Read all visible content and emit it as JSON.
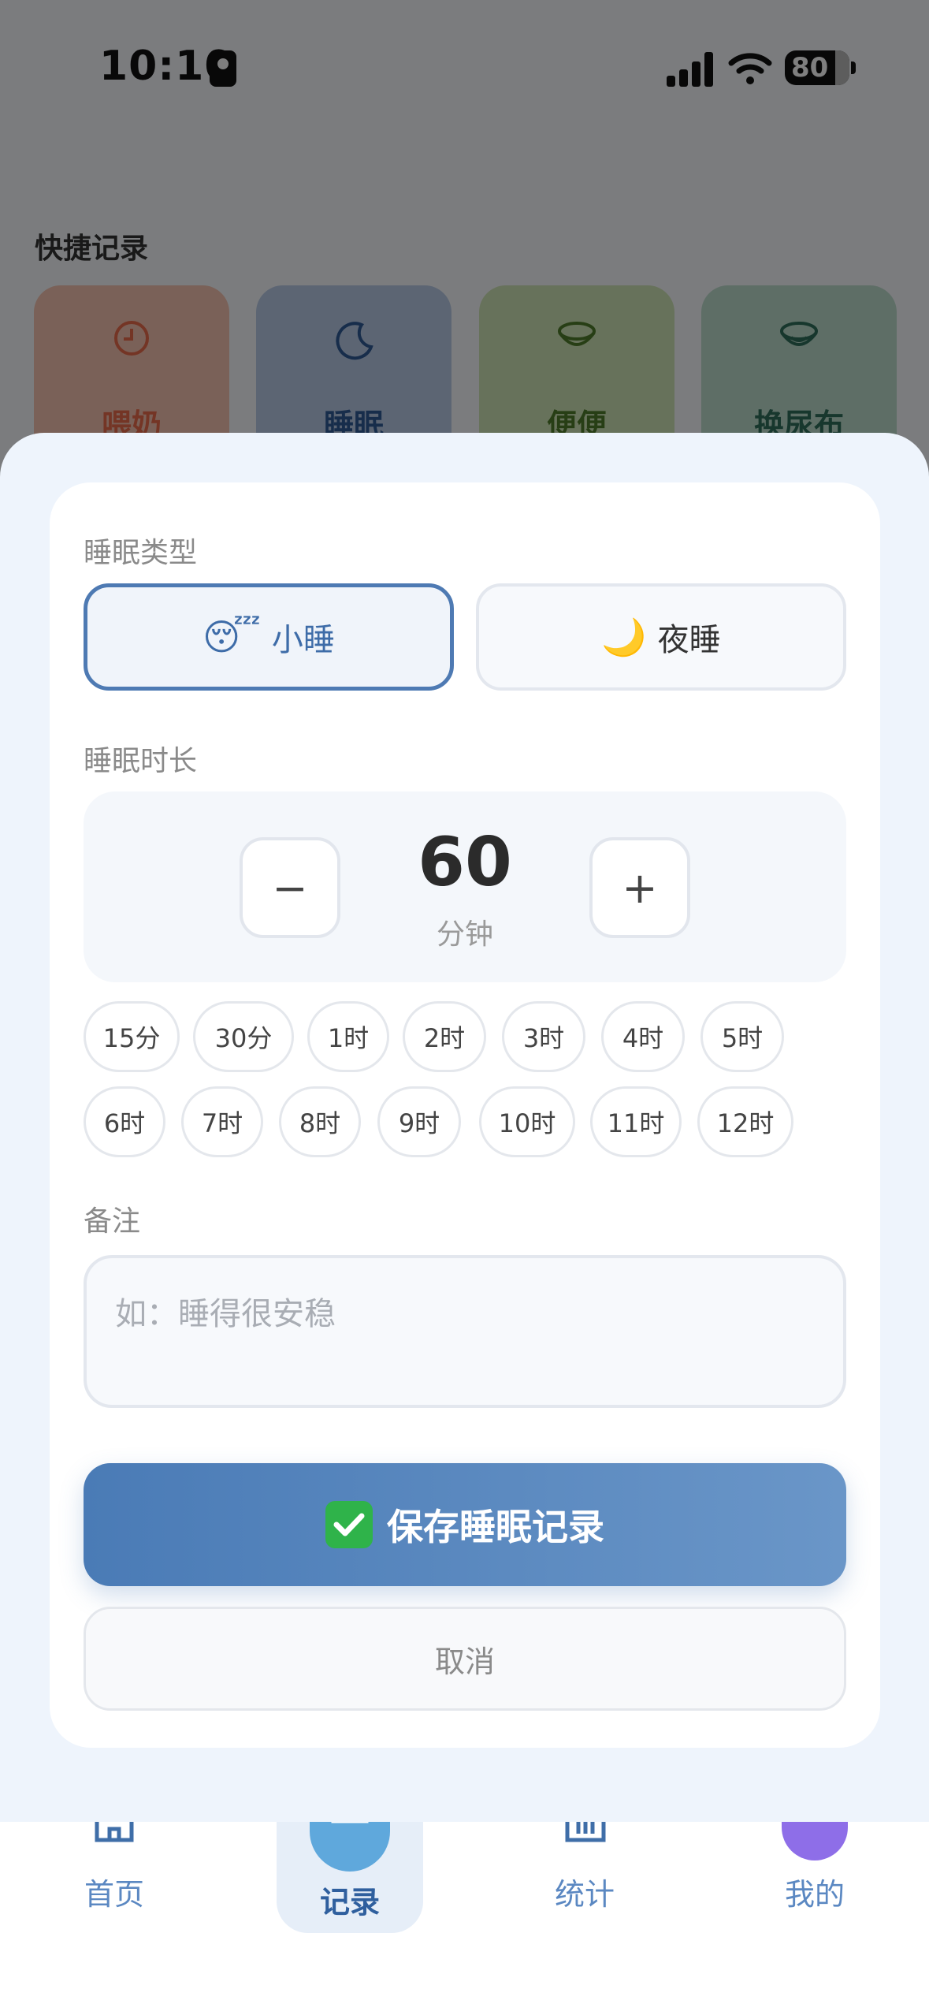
{
  "status_bar": {
    "time": "10:10",
    "battery": "80"
  },
  "quick": {
    "title": "快捷记录",
    "cards": [
      {
        "label": "喂奶",
        "color": "#e86a4a",
        "bg": "#f4c2b0"
      },
      {
        "label": "睡眠",
        "color": "#2e5a96",
        "bg": "#b9cae6"
      },
      {
        "label": "便便",
        "color": "#4f7d2a",
        "bg": "#cfe4b6"
      },
      {
        "label": "换尿布",
        "color": "#2f6e5a",
        "bg": "#bcdccd"
      }
    ]
  },
  "tabs": [
    {
      "label": "首页"
    },
    {
      "label": "记录"
    },
    {
      "label": "统计"
    },
    {
      "label": "我的"
    }
  ],
  "modal": {
    "type_label": "睡眠类型",
    "types": [
      {
        "emoji": "😴",
        "label": "小睡",
        "active": true
      },
      {
        "emoji": "🌙",
        "label": "夜睡",
        "active": false
      }
    ],
    "duration_label": "睡眠时长",
    "duration": {
      "value": "60",
      "unit": "分钟",
      "minus": "−",
      "plus": "+"
    },
    "presets_row1": [
      "15分",
      "30分",
      "1时",
      "2时",
      "3时",
      "4时",
      "5时"
    ],
    "presets_row2": [
      "6时",
      "7时",
      "8时",
      "9时",
      "10时",
      "11时",
      "12时"
    ],
    "note_label": "备注",
    "note_placeholder": "如：睡得很安稳",
    "note_value": "",
    "save_label": "保存睡眠记录",
    "cancel_label": "取消"
  },
  "colors": {
    "accent": "#4e7ab3",
    "save_gradient_start": "#4a7bb6",
    "save_gradient_end": "#6a96c8",
    "check_green": "#2fb34a"
  }
}
